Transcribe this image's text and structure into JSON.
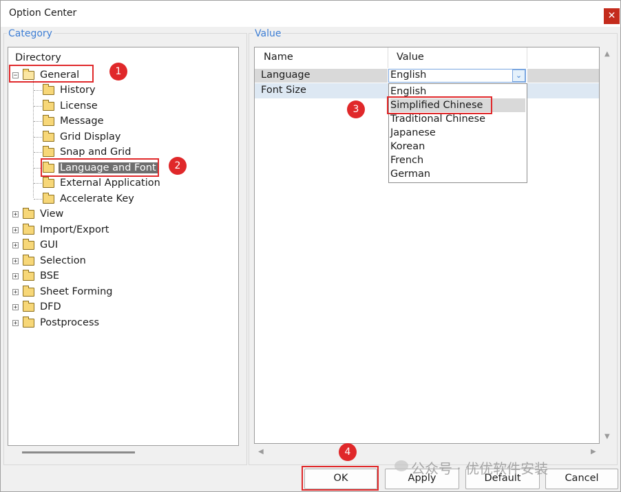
{
  "window": {
    "title": "Option Center",
    "close_glyph": "✕"
  },
  "category": {
    "group_label": "Category",
    "root_label": "Directory",
    "general": {
      "label": "General",
      "expander": "−"
    },
    "general_children": [
      "History",
      "License",
      "Message",
      "Grid Display",
      "Snap and Grid",
      "Language and Font",
      "External Application",
      "Accelerate Key"
    ],
    "selected": "Language and Font",
    "collapsed": [
      "View",
      "Import/Export",
      "GUI",
      "Selection",
      "BSE",
      "Sheet Forming",
      "DFD",
      "Postprocess"
    ],
    "collapsed_expander": "+"
  },
  "value": {
    "group_label": "Value",
    "columns": [
      "Name",
      "Value"
    ],
    "rows": [
      {
        "name": "Language",
        "value": "English"
      },
      {
        "name": "Font Size",
        "value": ""
      }
    ],
    "dropdown_options": [
      "English",
      "Simplified Chinese",
      "Traditional Chinese",
      "Japanese",
      "Korean",
      "French",
      "German"
    ],
    "highlighted_option": "Simplified Chinese"
  },
  "buttons": {
    "ok": "OK",
    "apply": "Apply",
    "default": "Default",
    "cancel": "Cancel"
  },
  "annotations": [
    "1",
    "2",
    "3",
    "4"
  ],
  "watermark": "公众号 · 优优软件安装",
  "colors": {
    "accent": "#3c7dd4",
    "highlight_red": "#e0282a",
    "selected_bg": "#6e6e6e"
  }
}
